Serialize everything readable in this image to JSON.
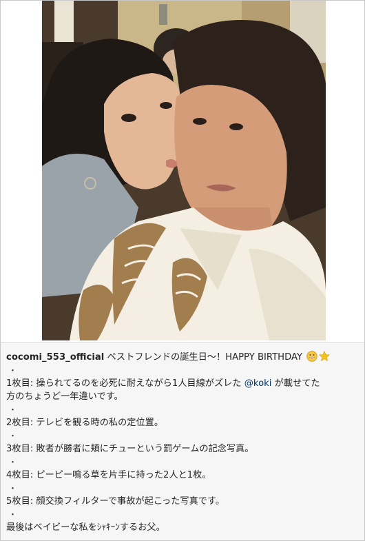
{
  "post": {
    "username": "cocomi_553_official",
    "headline": " ベストフレンドの誕生日〜！HAPPY BIRTHDAY ",
    "headline_emojis": [
      "grinning-face-icon",
      "star-icon"
    ],
    "dot": "・",
    "line1_a": "1枚目: 操られてるのを必死に耐えながら1人目線がズレた ",
    "mention": "@koki",
    "line1_b": " が載せてた",
    "line1_c": "方のちょうど一年違いです。",
    "line2": "2枚目: テレビを観る時の私の定位置。",
    "line3": "3枚目: 敗者が勝者に頬にチューという罰ゲームの記念写真。",
    "line4": "4枚目: ピーピー鳴る草を片手に持った2人と1枚。",
    "line5": "5枚目: 顔交換フィルターで事故が起こった写真です。",
    "line6": "最後はベイビーな私をｼｬｷｰﾝするお父。"
  },
  "colors": {
    "mention": "#00376b",
    "text": "#262626",
    "caption_bg": "#f6f6f6",
    "shirt": "#f4efe2",
    "shirt_pattern": "#a27d4e"
  }
}
